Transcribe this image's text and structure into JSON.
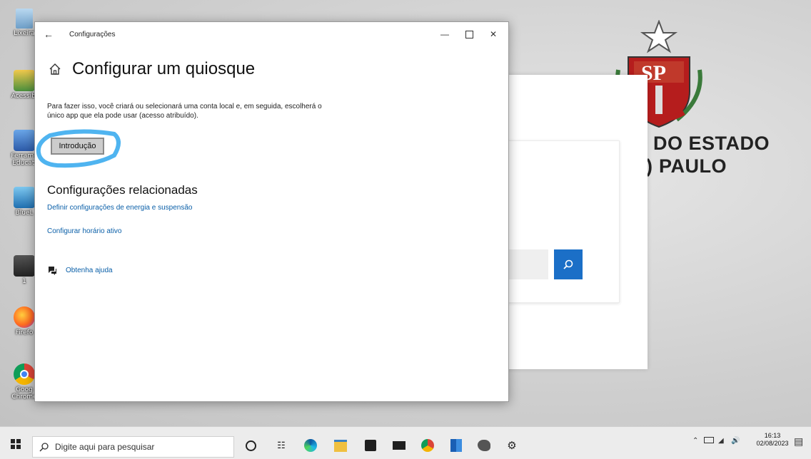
{
  "window": {
    "title": "Configurações",
    "page_title": "Configurar um quiosque",
    "description": "Para fazer isso, você criará ou selecionará uma conta local e, em seguida, escolherá o único app que ela pode usar (acesso atribuído).",
    "start_button_label": "Introdução",
    "related_title": "Configurações relacionadas",
    "related_links": [
      "Definir configurações de energia e suspensão",
      "Configurar horário ativo"
    ],
    "help_label": "Obtenha ajuda"
  },
  "wallpaper": {
    "line1": "DO ESTADO",
    "line2": "PAULO"
  },
  "desktop_icons": [
    {
      "label": "Lixeira",
      "icon": "recycle-bin-icon"
    },
    {
      "label": "Acessibi",
      "icon": "accessibility-icon"
    },
    {
      "label": "Ferrame Educati",
      "icon": "tools-icon"
    },
    {
      "label": "BlueL",
      "icon": "bluelab-icon"
    },
    {
      "label": "1",
      "icon": "screen-icon"
    },
    {
      "label": "Firefo",
      "icon": "firefox-icon"
    },
    {
      "label": "Goog Chrome",
      "icon": "chrome-icon"
    }
  ],
  "taskbar": {
    "search_placeholder": "Digite aqui para pesquisar",
    "time": "16:13",
    "date": "02/08/2023"
  },
  "colors": {
    "accent": "#0a5fa8",
    "search_button": "#1b6fc7",
    "highlight": "#4fb4f0"
  }
}
